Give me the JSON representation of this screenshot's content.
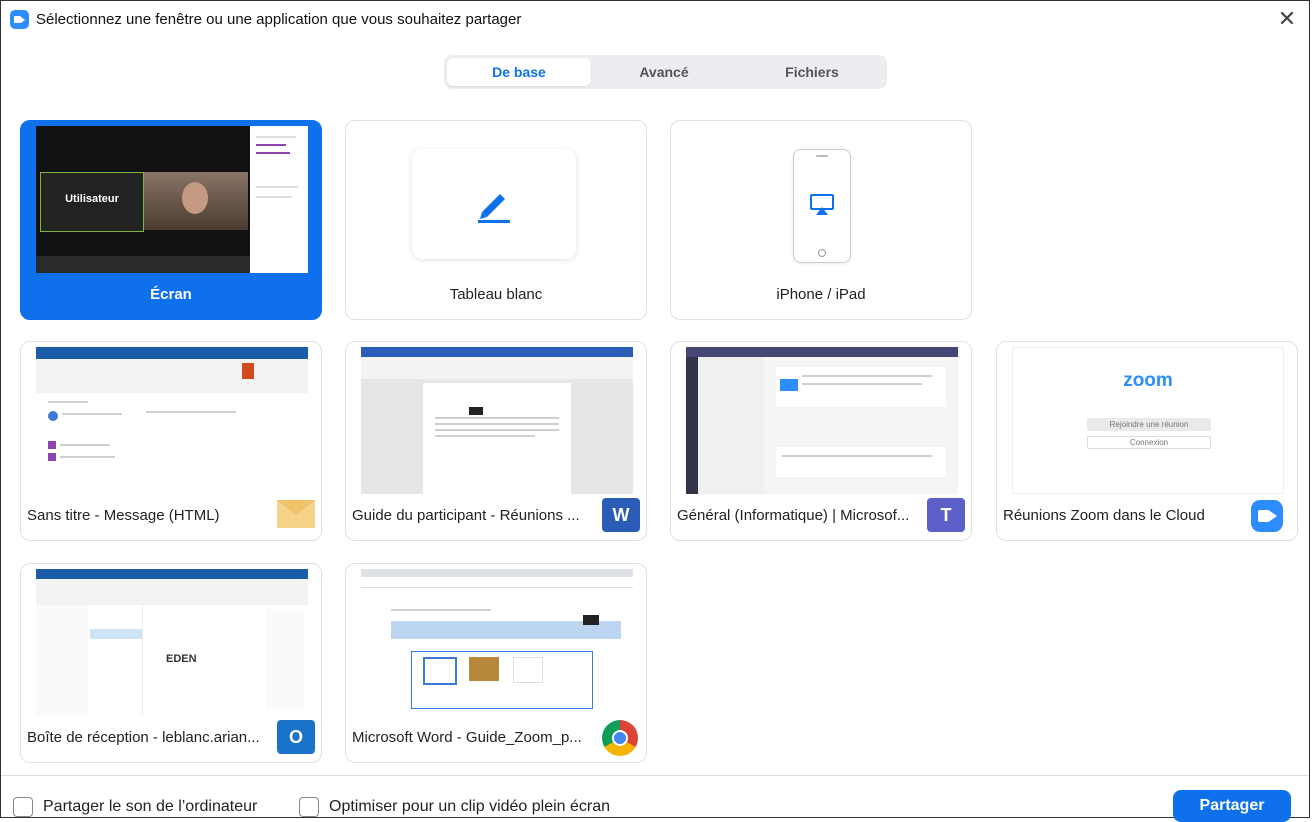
{
  "window": {
    "title": "Sélectionnez une fenêtre ou une application que vous souhaitez partager"
  },
  "tabs": [
    {
      "label": "De base",
      "active": true
    },
    {
      "label": "Avancé",
      "active": false
    },
    {
      "label": "Fichiers",
      "active": false
    }
  ],
  "cards": {
    "screen": {
      "label": "Écran",
      "thumb_text": "Utilisateur"
    },
    "whiteboard": {
      "label": "Tableau blanc",
      "icon": "pencil-icon"
    },
    "iphone": {
      "label": "iPhone / iPad",
      "icon": "airplay-icon"
    },
    "outlook_message": {
      "label": "Sans titre - Message (HTML)",
      "app_icon": "mail-icon"
    },
    "word_guide": {
      "label": "Guide du participant - Réunions ...",
      "app_icon": "word-icon",
      "badge_text": "W"
    },
    "teams": {
      "label": "Général (Informatique) | Microsof...",
      "app_icon": "teams-icon",
      "badge_text": "T"
    },
    "zoom_cloud": {
      "label": "Réunions Zoom dans le Cloud",
      "app_icon": "zoom-icon",
      "logo_text": "zoom",
      "btn_join": "Rejoindre une réunion",
      "btn_connect": "Connexion"
    },
    "outlook_inbox": {
      "label": "Boîte de réception - leblanc.arian...",
      "app_icon": "outlook-icon",
      "badge_text": "O",
      "logo_text": "EDEN"
    },
    "chrome_word": {
      "label": "Microsoft Word - Guide_Zoom_p...",
      "app_icon": "chrome-icon"
    }
  },
  "footer": {
    "share_sound": "Partager le son de l’ordinateur",
    "optimize_video": "Optimiser pour un clip vidéo plein écran",
    "share_button": "Partager"
  },
  "colors": {
    "accent": "#0e71eb",
    "zoom_blue": "#2d8cff"
  }
}
